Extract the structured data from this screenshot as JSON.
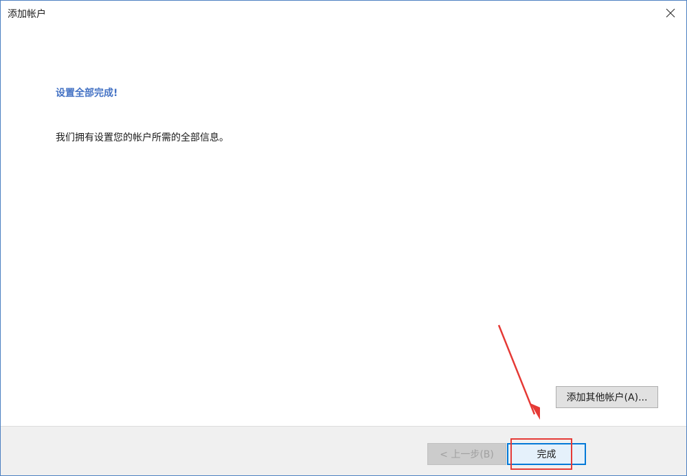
{
  "window": {
    "title": "添加帐户"
  },
  "content": {
    "heading": "设置全部完成!",
    "message": "我们拥有设置您的帐户所需的全部信息。"
  },
  "buttons": {
    "add_other_label": "添加其他帐户(A)...",
    "back_label": "< 上一步(B)",
    "finish_label": "完成"
  },
  "colors": {
    "heading": "#4472c4",
    "window_border": "#4a7fc1",
    "footer_bg": "#f0f0f0",
    "annotation": "#e53935"
  },
  "icons": {
    "close": "close-icon"
  }
}
